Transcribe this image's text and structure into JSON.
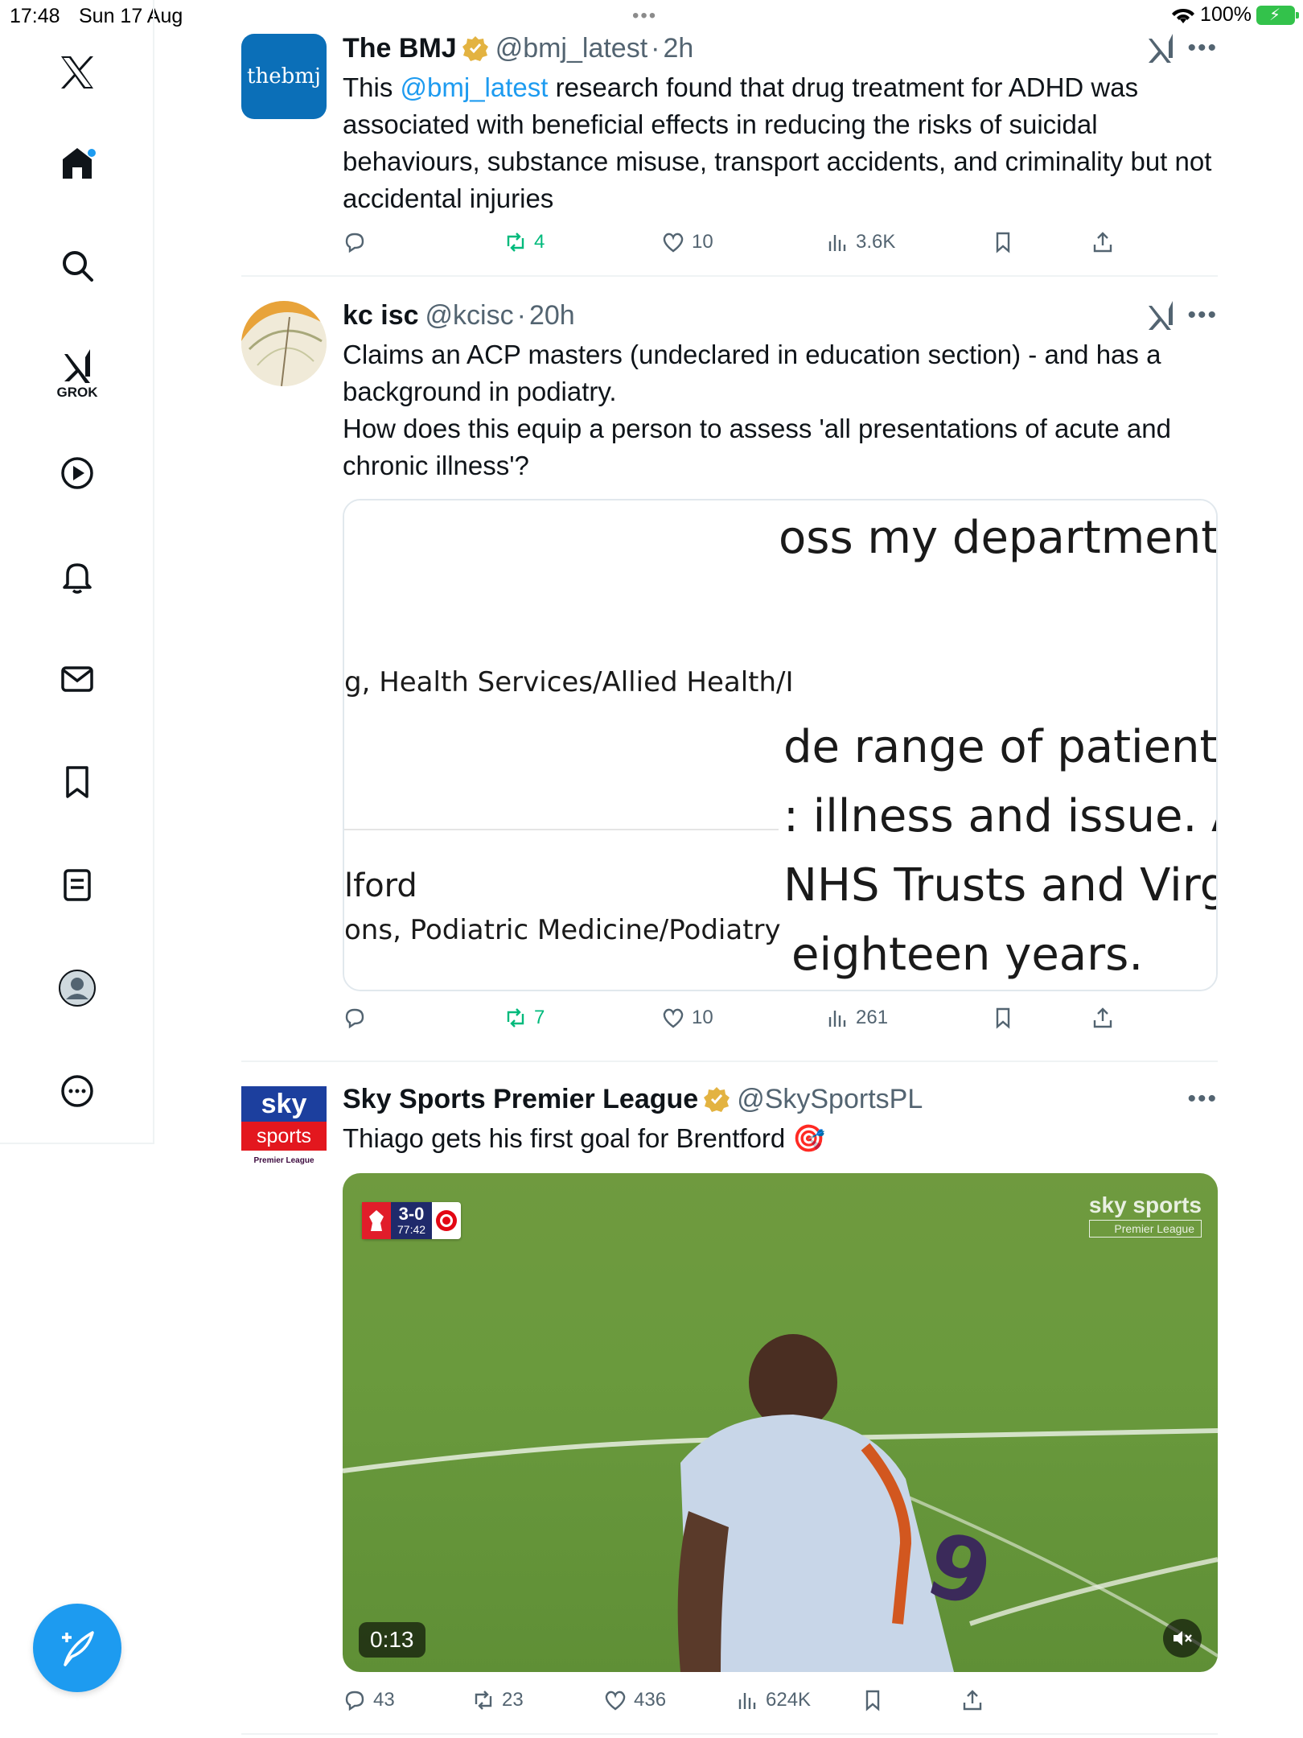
{
  "status_bar": {
    "time": "17:48",
    "date": "Sun 17 Aug",
    "battery": "100%"
  },
  "sidebar": {
    "grok_label": "GROK",
    "items": [
      "home-icon",
      "search-icon",
      "grok-icon",
      "video-icon",
      "notifications-icon",
      "messages-icon",
      "bookmarks-icon",
      "lists-icon",
      "profile-icon",
      "more-icon"
    ]
  },
  "tweets": [
    {
      "name": "The BMJ",
      "handle": "@bmj_latest",
      "time": "2h",
      "verified": true,
      "avatar_text": "thebmj",
      "text_pre": "This ",
      "mention": "@bmj_latest",
      "text_post": " research found that drug treatment for ADHD was associated with beneficial effects in reducing the risks of suicidal behaviours, substance misuse, transport accidents, and criminality but not accidental injuries",
      "stats": {
        "replies": "",
        "reposts": "4",
        "likes": "10",
        "views": "3.6K"
      }
    },
    {
      "name": "kc isc",
      "handle": "@kcisc",
      "time": "20h",
      "verified": false,
      "text": "Claims an ACP masters (undeclared in education section) - and has a background in podiatry.\nHow does this equip a person to assess 'all presentations of acute and chronic illness'?",
      "image_fragments": {
        "line1": "oss my department",
        "line2": "g, Health Services/Allied Health/I",
        "line3": "de range of patients",
        "line4": ": illness and issue. Ac",
        "line5": "lford",
        "line6": "NHS Trusts and Virg",
        "line7": "ons, Podiatric Medicine/Podiatry",
        "line8": "eighteen years."
      },
      "stats": {
        "replies": "",
        "reposts": "7",
        "likes": "10",
        "views": "261"
      }
    },
    {
      "name": "Sky Sports Premier League",
      "handle": "@SkySportsPL",
      "verified": true,
      "avatar_top": "sky",
      "avatar_mid": "sports",
      "avatar_bot": "Premier League",
      "text": "Thiago gets his first goal for Brentford 🎯",
      "video": {
        "duration": "0:13",
        "score": "3-0",
        "clock": "77:42",
        "watermark_top": "sky sports",
        "watermark_bot": "Premier League"
      },
      "stats": {
        "replies": "43",
        "reposts": "23",
        "likes": "436",
        "views": "624K"
      }
    }
  ]
}
